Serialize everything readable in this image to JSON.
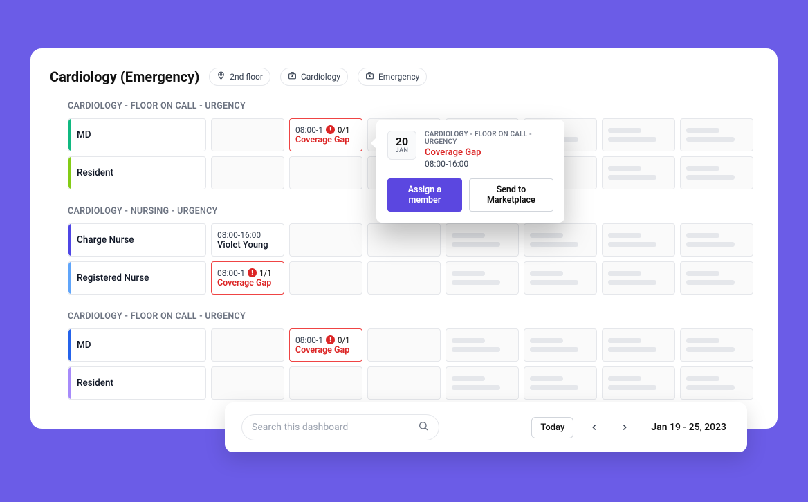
{
  "header": {
    "title": "Cardiology (Emergency)",
    "tags": {
      "floor": "2nd floor",
      "dept": "Cardiology",
      "type": "Emergency"
    }
  },
  "colors": {
    "accent_md_1": "#10b981",
    "accent_resident_1": "#84cc16",
    "accent_charge_nurse": "#4f46e5",
    "accent_reg_nurse": "#60a5fa",
    "accent_md_2": "#2563eb",
    "accent_resident_2": "#a78bfa",
    "gap_red": "#dc2626",
    "primary": "#5b47e0"
  },
  "groups": [
    {
      "title": "CARDIOLOGY - FLOOR ON CALL - URGENCY",
      "rows": [
        {
          "role": "MD",
          "accent": "accent_md_1",
          "cells": [
            {
              "type": "empty"
            },
            {
              "type": "gap",
              "time": "08:00-1",
              "count": "0/1",
              "label": "Coverage Gap"
            },
            {
              "type": "empty"
            },
            {
              "type": "placeholder"
            },
            {
              "type": "placeholder"
            },
            {
              "type": "placeholder"
            },
            {
              "type": "placeholder"
            }
          ]
        },
        {
          "role": "Resident",
          "accent": "accent_resident_1",
          "cells": [
            {
              "type": "empty"
            },
            {
              "type": "empty"
            },
            {
              "type": "empty"
            },
            {
              "type": "empty"
            },
            {
              "type": "empty"
            },
            {
              "type": "placeholder"
            },
            {
              "type": "placeholder"
            }
          ]
        }
      ]
    },
    {
      "title": "CARDIOLOGY - NURSING - URGENCY",
      "rows": [
        {
          "role": "Charge Nurse",
          "accent": "accent_charge_nurse",
          "cells": [
            {
              "type": "filled",
              "time": "08:00-16:00",
              "assignee": "Violet Young"
            },
            {
              "type": "empty"
            },
            {
              "type": "empty"
            },
            {
              "type": "placeholder"
            },
            {
              "type": "placeholder"
            },
            {
              "type": "placeholder"
            },
            {
              "type": "placeholder"
            }
          ]
        },
        {
          "role": "Registered Nurse",
          "accent": "accent_reg_nurse",
          "cells": [
            {
              "type": "gap",
              "time": "08:00-1",
              "count": "1/1",
              "label": "Coverage Gap"
            },
            {
              "type": "empty"
            },
            {
              "type": "empty"
            },
            {
              "type": "placeholder"
            },
            {
              "type": "placeholder"
            },
            {
              "type": "placeholder"
            },
            {
              "type": "placeholder"
            }
          ]
        }
      ]
    },
    {
      "title": "CARDIOLOGY - FLOOR ON CALL - URGENCY",
      "rows": [
        {
          "role": "MD",
          "accent": "accent_md_2",
          "cells": [
            {
              "type": "empty"
            },
            {
              "type": "gap",
              "time": "08:00-1",
              "count": "0/1",
              "label": "Coverage Gap"
            },
            {
              "type": "empty"
            },
            {
              "type": "placeholder"
            },
            {
              "type": "placeholder"
            },
            {
              "type": "placeholder"
            },
            {
              "type": "placeholder"
            }
          ]
        },
        {
          "role": "Resident",
          "accent": "accent_resident_2",
          "cells": [
            {
              "type": "empty"
            },
            {
              "type": "empty"
            },
            {
              "type": "empty"
            },
            {
              "type": "placeholder"
            },
            {
              "type": "placeholder"
            },
            {
              "type": "placeholder"
            },
            {
              "type": "placeholder"
            }
          ]
        }
      ]
    }
  ],
  "popover": {
    "day": "20",
    "month": "JAN",
    "group": "CARDIOLOGY - FLOOR ON CALL - URGENCY",
    "gap_label": "Coverage Gap",
    "time": "08:00-16:00",
    "assign_label": "Assign a member",
    "marketplace_label": "Send to Marketplace"
  },
  "bottom": {
    "search_placeholder": "Search this dashboard",
    "today_label": "Today",
    "date_range": "Jan 19 - 25, 2023"
  }
}
